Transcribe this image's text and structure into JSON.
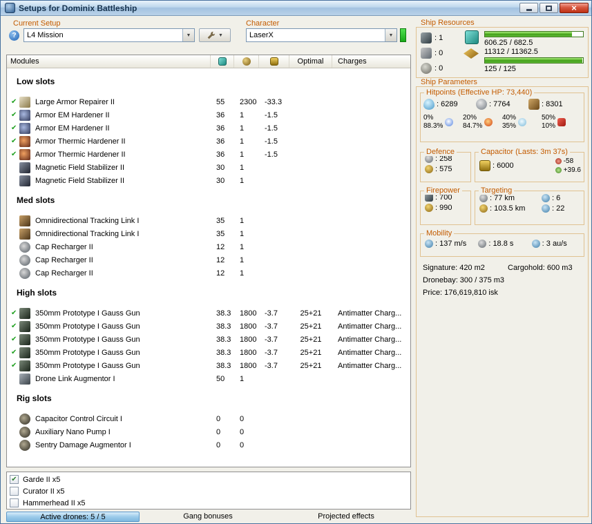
{
  "ui": {
    "check_glyph": "✔",
    "combo_arrow": "▼",
    "help_glyph": "?"
  },
  "window": {
    "title": "Setups for Dominix Battleship"
  },
  "header": {
    "current_setup_label": "Current Setup",
    "setup_value": "L4 Mission",
    "character_label": "Character",
    "character_value": "LaserX"
  },
  "modules": {
    "title": "Modules",
    "optimal_col": "Optimal",
    "charges_col": "Charges",
    "sections": [
      {
        "name": "Low slots",
        "rows": [
          {
            "active": true,
            "icon": "repairer",
            "name": "Large Armor Repairer II",
            "cpu": "55",
            "pg": "2300",
            "cap": "-33.3",
            "optimal": "",
            "charges": ""
          },
          {
            "active": true,
            "icon": "hardener-em",
            "name": "Armor EM Hardener II",
            "cpu": "36",
            "pg": "1",
            "cap": "-1.5",
            "optimal": "",
            "charges": ""
          },
          {
            "active": true,
            "icon": "hardener-em",
            "name": "Armor EM Hardener II",
            "cpu": "36",
            "pg": "1",
            "cap": "-1.5",
            "optimal": "",
            "charges": ""
          },
          {
            "active": true,
            "icon": "hardener-th",
            "name": "Armor Thermic Hardener II",
            "cpu": "36",
            "pg": "1",
            "cap": "-1.5",
            "optimal": "",
            "charges": ""
          },
          {
            "active": true,
            "icon": "hardener-th",
            "name": "Armor Thermic Hardener II",
            "cpu": "36",
            "pg": "1",
            "cap": "-1.5",
            "optimal": "",
            "charges": ""
          },
          {
            "active": false,
            "icon": "magstab",
            "name": "Magnetic Field Stabilizer II",
            "cpu": "30",
            "pg": "1",
            "cap": "",
            "optimal": "",
            "charges": ""
          },
          {
            "active": false,
            "icon": "magstab",
            "name": "Magnetic Field Stabilizer II",
            "cpu": "30",
            "pg": "1",
            "cap": "",
            "optimal": "",
            "charges": ""
          }
        ]
      },
      {
        "name": "Med slots",
        "rows": [
          {
            "active": false,
            "icon": "tracklink",
            "name": "Omnidirectional Tracking Link I",
            "cpu": "35",
            "pg": "1",
            "cap": "",
            "optimal": "",
            "charges": ""
          },
          {
            "active": false,
            "icon": "tracklink",
            "name": "Omnidirectional Tracking Link I",
            "cpu": "35",
            "pg": "1",
            "cap": "",
            "optimal": "",
            "charges": ""
          },
          {
            "active": false,
            "icon": "capcharge",
            "name": "Cap Recharger II",
            "cpu": "12",
            "pg": "1",
            "cap": "",
            "optimal": "",
            "charges": ""
          },
          {
            "active": false,
            "icon": "capcharge",
            "name": "Cap Recharger II",
            "cpu": "12",
            "pg": "1",
            "cap": "",
            "optimal": "",
            "charges": ""
          },
          {
            "active": false,
            "icon": "capcharge",
            "name": "Cap Recharger II",
            "cpu": "12",
            "pg": "1",
            "cap": "",
            "optimal": "",
            "charges": ""
          }
        ]
      },
      {
        "name": "High slots",
        "rows": [
          {
            "active": true,
            "icon": "gun",
            "name": "350mm Prototype I Gauss Gun",
            "cpu": "38.3",
            "pg": "1800",
            "cap": "-3.7",
            "optimal": "25+21",
            "charges": "Antimatter Charg..."
          },
          {
            "active": true,
            "icon": "gun",
            "name": "350mm Prototype I Gauss Gun",
            "cpu": "38.3",
            "pg": "1800",
            "cap": "-3.7",
            "optimal": "25+21",
            "charges": "Antimatter Charg..."
          },
          {
            "active": true,
            "icon": "gun",
            "name": "350mm Prototype I Gauss Gun",
            "cpu": "38.3",
            "pg": "1800",
            "cap": "-3.7",
            "optimal": "25+21",
            "charges": "Antimatter Charg..."
          },
          {
            "active": true,
            "icon": "gun",
            "name": "350mm Prototype I Gauss Gun",
            "cpu": "38.3",
            "pg": "1800",
            "cap": "-3.7",
            "optimal": "25+21",
            "charges": "Antimatter Charg..."
          },
          {
            "active": true,
            "icon": "gun",
            "name": "350mm Prototype I Gauss Gun",
            "cpu": "38.3",
            "pg": "1800",
            "cap": "-3.7",
            "optimal": "25+21",
            "charges": "Antimatter Charg..."
          },
          {
            "active": false,
            "icon": "dronelink",
            "name": "Drone Link Augmentor I",
            "cpu": "50",
            "pg": "1",
            "cap": "",
            "optimal": "",
            "charges": ""
          }
        ]
      },
      {
        "name": "Rig slots",
        "rows": [
          {
            "active": false,
            "icon": "rig",
            "name": "Capacitor Control Circuit I",
            "cpu": "0",
            "pg": "0",
            "cap": "",
            "optimal": "",
            "charges": ""
          },
          {
            "active": false,
            "icon": "rig",
            "name": "Auxiliary Nano Pump I",
            "cpu": "0",
            "pg": "0",
            "cap": "",
            "optimal": "",
            "charges": ""
          },
          {
            "active": false,
            "icon": "rig",
            "name": "Sentry Damage Augmentor I",
            "cpu": "0",
            "pg": "0",
            "cap": "",
            "optimal": "",
            "charges": ""
          }
        ]
      }
    ]
  },
  "ship_resources": {
    "label": "Ship Resources",
    "turrets": ": 1",
    "launchers": ": 0",
    "calibration": ": 0",
    "cpu": "606.25 / 682.5",
    "powergrid": "11312 / 11362.5",
    "drone_bandwidth": "125 / 125"
  },
  "ship_parameters": {
    "label": "Ship Parameters",
    "hitpoints": {
      "label": "Hitpoints (Effective HP: 73,440)",
      "shield": ": 6289",
      "armor": ": 7764",
      "structure": ": 8301",
      "resists": [
        {
          "type": "em",
          "shield": "0%",
          "armor": "88.3%"
        },
        {
          "type": "thermal",
          "shield": "20%",
          "armor": "84.7%"
        },
        {
          "type": "kinetic",
          "shield": "40%",
          "armor": "35%"
        },
        {
          "type": "explosive",
          "shield": "50%",
          "armor": "10%"
        }
      ]
    },
    "defence": {
      "label": "Defence",
      "value1": ": 258",
      "value2": ": 575"
    },
    "capacitor": {
      "label": "Capacitor (Lasts: 3m 37s)",
      "amount": ": 6000",
      "drain": "-58",
      "recharge": "+39.6"
    },
    "firepower": {
      "label": "Firepower",
      "volley": ": 700",
      "dps": ": 990"
    },
    "targeting": {
      "label": "Targeting",
      "range": ": 77 km",
      "max_targets": ": 6",
      "scan_range": ": 103.5 km",
      "sensor_strength": ": 22"
    },
    "mobility": {
      "label": "Mobility",
      "speed": ": 137 m/s",
      "align_time": ": 18.8 s",
      "warp_speed": ": 3 au/s"
    },
    "signature": "Signature: 420 m2",
    "cargohold": "Cargohold: 600 m3",
    "dronebay": "Dronebay: 300 / 375 m3",
    "price": "Price: 176,619,810 isk"
  },
  "drones": [
    {
      "checked": true,
      "label": "Garde II x5"
    },
    {
      "checked": false,
      "label": "Curator II x5"
    },
    {
      "checked": false,
      "label": "Hammerhead II x5"
    }
  ],
  "statusbar": {
    "active_drones": "Active drones: 5 / 5",
    "gang_bonuses": "Gang bonuses",
    "projected_effects": "Projected effects"
  }
}
